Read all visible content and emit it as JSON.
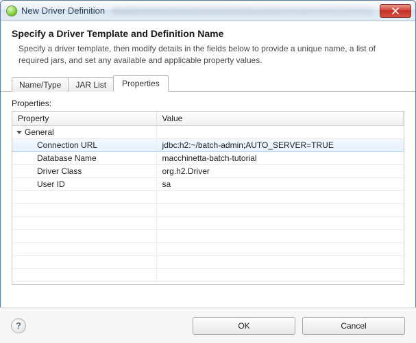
{
  "window": {
    "title": "New Driver Definition"
  },
  "header": {
    "heading": "Specify a Driver Template and Definition Name",
    "description": "Specify a driver template, then modify details in the fields below to provide a unique name, a list of required jars, and set any available and applicable property values."
  },
  "tabs": {
    "name_type": "Name/Type",
    "jar_list": "JAR List",
    "properties": "Properties"
  },
  "content": {
    "label": "Properties:",
    "columns": {
      "property": "Property",
      "value": "Value"
    },
    "group": "General",
    "rows": [
      {
        "property": "Connection URL",
        "value": "jdbc:h2:~/batch-admin;AUTO_SERVER=TRUE",
        "selected": true
      },
      {
        "property": "Database Name",
        "value": "macchinetta-batch-tutorial",
        "selected": false
      },
      {
        "property": "Driver Class",
        "value": "org.h2.Driver",
        "selected": false
      },
      {
        "property": "User ID",
        "value": "sa",
        "selected": false
      }
    ]
  },
  "footer": {
    "help": "?",
    "ok": "OK",
    "cancel": "Cancel"
  }
}
